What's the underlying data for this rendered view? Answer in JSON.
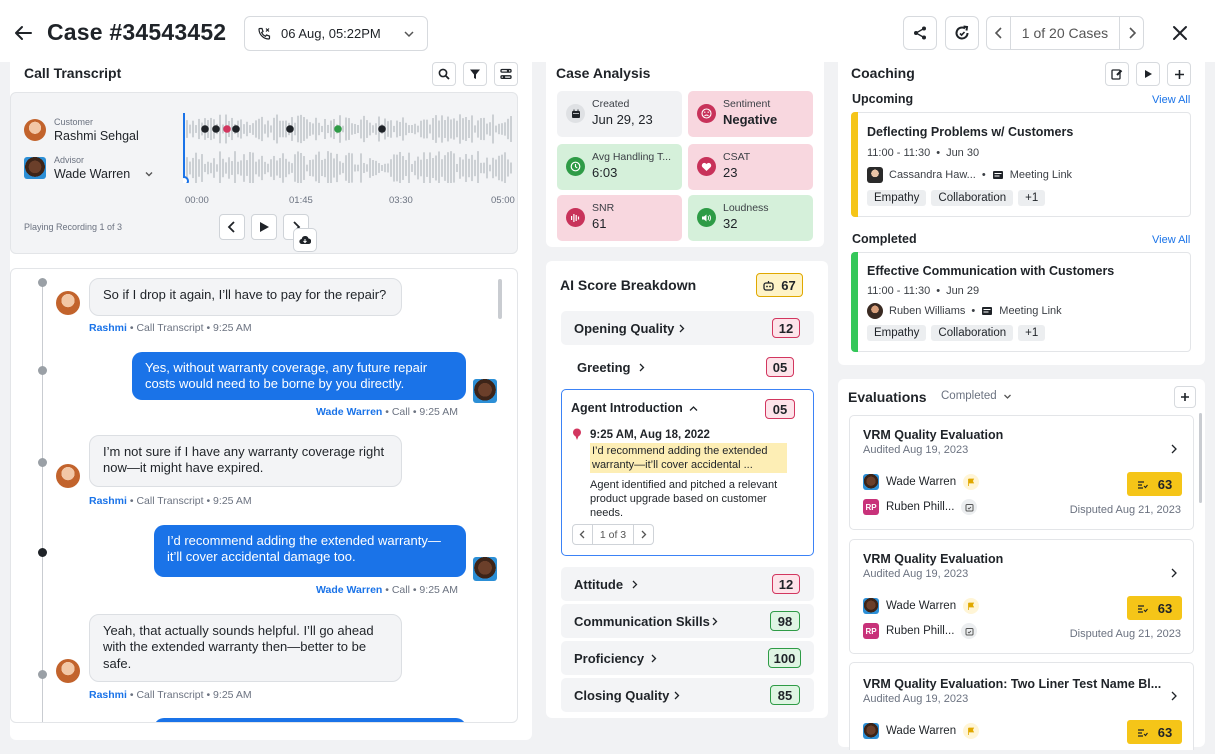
{
  "header": {
    "title": "Case #34543452",
    "date_label": "06 Aug, 05:22PM",
    "pager_text": "1 of 20 Cases"
  },
  "transcript": {
    "title": "Call Transcript",
    "customer_role": "Customer",
    "customer_name": "Rashmi Sehgal",
    "advisor_role": "Advisor",
    "advisor_name": "Wade Warren",
    "time_labels": [
      "00:00",
      "01:45",
      "03:30",
      "05:00"
    ],
    "playing_label": "Playing Recording 1 of 3",
    "messages": [
      {
        "side": "in",
        "text": "So if I drop it again, I’ll have to pay for the repair?",
        "author": "Rashmi",
        "meta": " • Call Transcript • 9:25 AM"
      },
      {
        "side": "out",
        "text": "Yes, without warranty coverage, any future repair costs would need to be borne by you directly.",
        "author": "Wade Warren",
        "meta": " • Call • 9:25 AM"
      },
      {
        "side": "in",
        "text": "I’m not sure if I have any warranty coverage right now—it might have expired.",
        "author": "Rashmi",
        "meta": " • Call Transcript • 9:25 AM"
      },
      {
        "side": "out",
        "text": "I’d recommend adding the extended warranty—it’ll cover accidental damage too.",
        "author": "Wade Warren",
        "meta": " • Call • 9:25 AM"
      },
      {
        "side": "in",
        "text": "Yeah, that actually sounds helpful. I’ll go ahead with the extended warranty then—better to be safe.",
        "author": "Rashmi",
        "meta": " • Call Transcript • 9:25 AM"
      }
    ]
  },
  "analysis": {
    "title": "Case Analysis",
    "tiles": [
      {
        "label": "Created",
        "value": "Jun 29, 23"
      },
      {
        "label": "Sentiment",
        "value": "Negative"
      },
      {
        "label": "Avg Handling T...",
        "value": "6:03"
      },
      {
        "label": "CSAT",
        "value": "23"
      },
      {
        "label": "SNR",
        "value": "61"
      },
      {
        "label": "Loudness",
        "value": "32"
      }
    ]
  },
  "ai": {
    "title": "AI Score Breakdown",
    "total": "67",
    "criteria": [
      {
        "label": "Opening Quality",
        "score": "12"
      },
      {
        "label": "Greeting",
        "score": "05"
      },
      {
        "label": "Agent Introduction",
        "score": "05"
      },
      {
        "label": "Attitude",
        "score": "12"
      },
      {
        "label": "Communication Skills",
        "score": "98"
      },
      {
        "label": "Proficiency",
        "score": "100"
      },
      {
        "label": "Closing Quality",
        "score": "85"
      }
    ],
    "detail": {
      "time": "9:25 AM, Aug 18, 2022",
      "quote": "I’d recommend adding the extended warranty—it’ll cover accidental ...",
      "note": "Agent identified and pitched a relevant product upgrade based on customer needs.",
      "pager": "1 of 3"
    }
  },
  "coaching": {
    "title": "Coaching",
    "upcoming_label": "Upcoming",
    "completed_label": "Completed",
    "view_all": "View All",
    "upcoming": {
      "title": "Deflecting Problems w/ Customers",
      "time": "11:00 - 11:30",
      "date": "Jun 30",
      "person": "Cassandra Haw...",
      "link": "Meeting Link",
      "chips": [
        "Empathy",
        "Collaboration",
        "+1"
      ]
    },
    "completed": {
      "title": "Effective Communication with Customers",
      "time": "11:00 - 11:30",
      "date": "Jun 29",
      "person": "Ruben Williams",
      "link": "Meeting Link",
      "chips": [
        "Empathy",
        "Collaboration",
        "+1"
      ]
    }
  },
  "evaluations": {
    "title": "Evaluations",
    "filter": "Completed",
    "cards": [
      {
        "title": "VRM Quality Evaluation",
        "audited": "Audited Aug 19, 2023",
        "agent": "Wade Warren",
        "reviewer": "Ruben Phill...",
        "reviewer_initials": "RP",
        "score": "63",
        "disputed": "Disputed Aug 21, 2023"
      },
      {
        "title": "VRM Quality Evaluation",
        "audited": "Audited Aug 19, 2023",
        "agent": "Wade Warren",
        "reviewer": "Ruben Phill...",
        "reviewer_initials": "RP",
        "score": "63",
        "disputed": "Disputed Aug 21, 2023"
      },
      {
        "title": "VRM Quality Evaluation: Two Liner Test Name Bl...",
        "audited": "Audited Aug 19, 2023",
        "agent": "Wade Warren",
        "score": "63"
      }
    ]
  },
  "colors": {
    "accent_blue": "#1a73e8",
    "score_yellow": "#f5c518",
    "upcoming_bar": "#f5c518",
    "completed_bar": "#34c759",
    "negative_pink": "#f8d7df",
    "positive_green": "#d5f0da"
  }
}
